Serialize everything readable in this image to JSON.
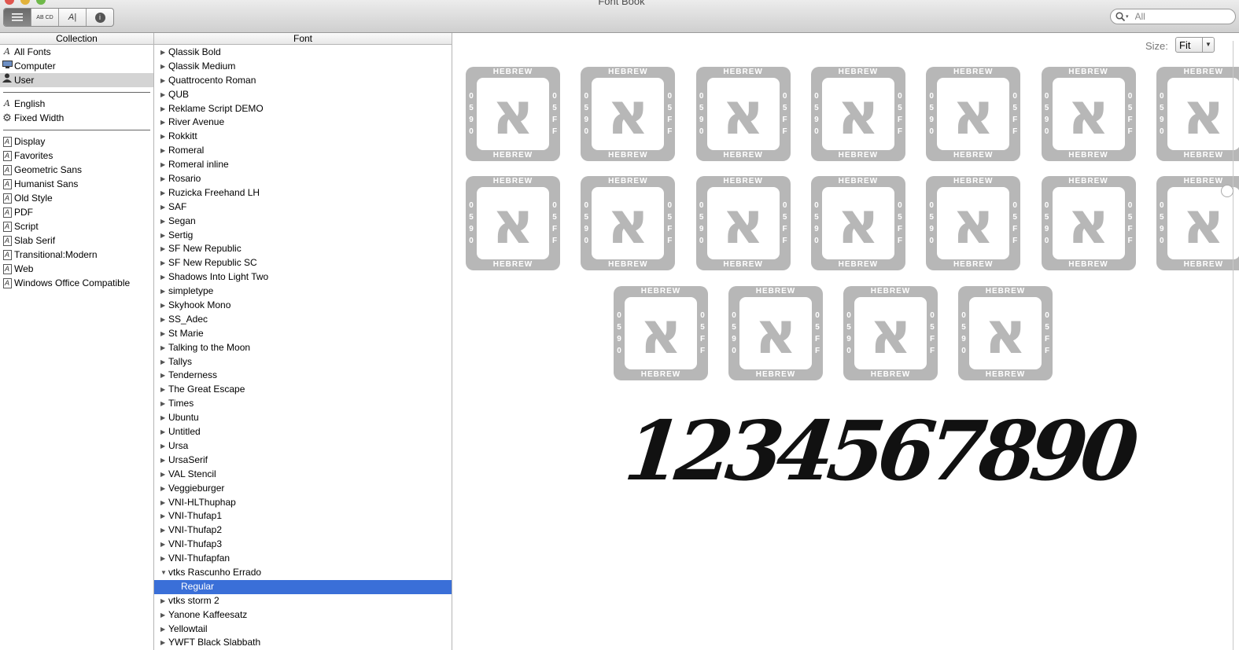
{
  "window": {
    "title": "Font Book"
  },
  "toolbar": {
    "view_buttons": [
      {
        "name": "list-view",
        "icon": "list-icon",
        "label": ""
      },
      {
        "name": "sample-view",
        "icon": "abcd-icon",
        "label": "AB CD"
      },
      {
        "name": "custom-view",
        "icon": "type-cursor-icon",
        "label": "A|"
      },
      {
        "name": "info-view",
        "icon": "info-icon",
        "label": "i"
      }
    ],
    "search": {
      "placeholder": "All"
    }
  },
  "collection": {
    "header": "Collection",
    "group1": [
      {
        "label": "All Fonts",
        "icon": "font-icon"
      },
      {
        "label": "Computer",
        "icon": "computer-icon"
      },
      {
        "label": "User",
        "icon": "user-icon",
        "selected": true
      }
    ],
    "group2": [
      {
        "label": "English",
        "icon": "font-icon"
      },
      {
        "label": "Fixed Width",
        "icon": "gear-icon"
      }
    ],
    "group3": [
      {
        "label": "Display"
      },
      {
        "label": "Favorites"
      },
      {
        "label": "Geometric Sans"
      },
      {
        "label": "Humanist Sans"
      },
      {
        "label": "Old Style"
      },
      {
        "label": "PDF"
      },
      {
        "label": "Script"
      },
      {
        "label": "Slab Serif"
      },
      {
        "label": "Transitional:Modern"
      },
      {
        "label": "Web"
      },
      {
        "label": "Windows Office Compatible"
      }
    ]
  },
  "fonts": {
    "header": "Font",
    "items": [
      "Qlassik Bold",
      "Qlassik Medium",
      "Quattrocento Roman",
      "QUB",
      "Reklame Script DEMO",
      "River Avenue",
      "Rokkitt",
      "Romeral",
      "Romeral inline",
      "Rosario",
      "Ruzicka Freehand LH",
      "SAF",
      "Segan",
      "Sertig",
      "SF New Republic",
      "SF New Republic SC",
      "Shadows Into Light Two",
      "simpletype",
      "Skyhook Mono",
      "SS_Adec",
      "St Marie",
      "Talking to the Moon",
      "Tallys",
      "Tenderness",
      "The Great Escape",
      "Times",
      "Ubuntu",
      "Untitled",
      "Ursa",
      "UrsaSerif",
      "VAL Stencil",
      "Veggieburger",
      "VNI-HLThuphap",
      "VNI-Thufap1",
      "VNI-Thufap2",
      "VNI-Thufap3",
      "VNI-Thufapfan",
      "vtks Rascunho  Errado"
    ],
    "expanded_index": 37,
    "selected_face": "Regular",
    "items_after": [
      "vtks storm 2",
      "Yanone Kaffeesatz",
      "Yellowtail",
      "YWFT Black Slabbath"
    ]
  },
  "preview": {
    "size_label": "Size:",
    "size_value": "Fit",
    "missing_glyph": {
      "char": "א",
      "top": "HEBREW",
      "bottom": "HEBREW",
      "left": "0590",
      "right": "05FF"
    },
    "missing_glyph_count": 18,
    "sample_text": "1234567890"
  }
}
